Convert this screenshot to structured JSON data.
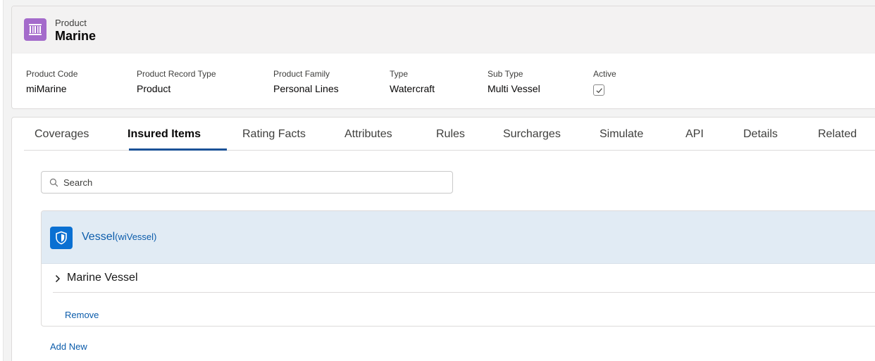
{
  "header": {
    "object_label": "Product",
    "record_name": "Marine",
    "fields": [
      {
        "label": "Product Code",
        "value": "miMarine"
      },
      {
        "label": "Product Record Type",
        "value": "Product"
      },
      {
        "label": "Product Family",
        "value": "Personal Lines"
      },
      {
        "label": "Type",
        "value": "Watercraft"
      },
      {
        "label": "Sub Type",
        "value": "Multi Vessel"
      }
    ],
    "active": {
      "label": "Active",
      "checked": true
    }
  },
  "tabs": [
    {
      "label": "Coverages",
      "active": false
    },
    {
      "label": "Insured Items",
      "active": true
    },
    {
      "label": "Rating Facts",
      "active": false
    },
    {
      "label": "Attributes",
      "active": false
    },
    {
      "label": "Rules",
      "active": false
    },
    {
      "label": "Surcharges",
      "active": false
    },
    {
      "label": "Simulate",
      "active": false
    },
    {
      "label": "API",
      "active": false
    },
    {
      "label": "Details",
      "active": false
    },
    {
      "label": "Related",
      "active": false
    }
  ],
  "search": {
    "placeholder": "Search",
    "value": ""
  },
  "insured_item": {
    "name": "Vessel",
    "code": "(wiVessel)",
    "icon": "shield-icon",
    "child_label": "Marine Vessel",
    "remove_label": "Remove"
  },
  "add_new_label": "Add New",
  "colors": {
    "product_icon_bg": "#a46bcb",
    "item_icon_bg": "#0a70d2",
    "link": "#0b5cab",
    "active_tab_underline": "#1b5297",
    "item_header_bg": "#e1ebf4"
  }
}
